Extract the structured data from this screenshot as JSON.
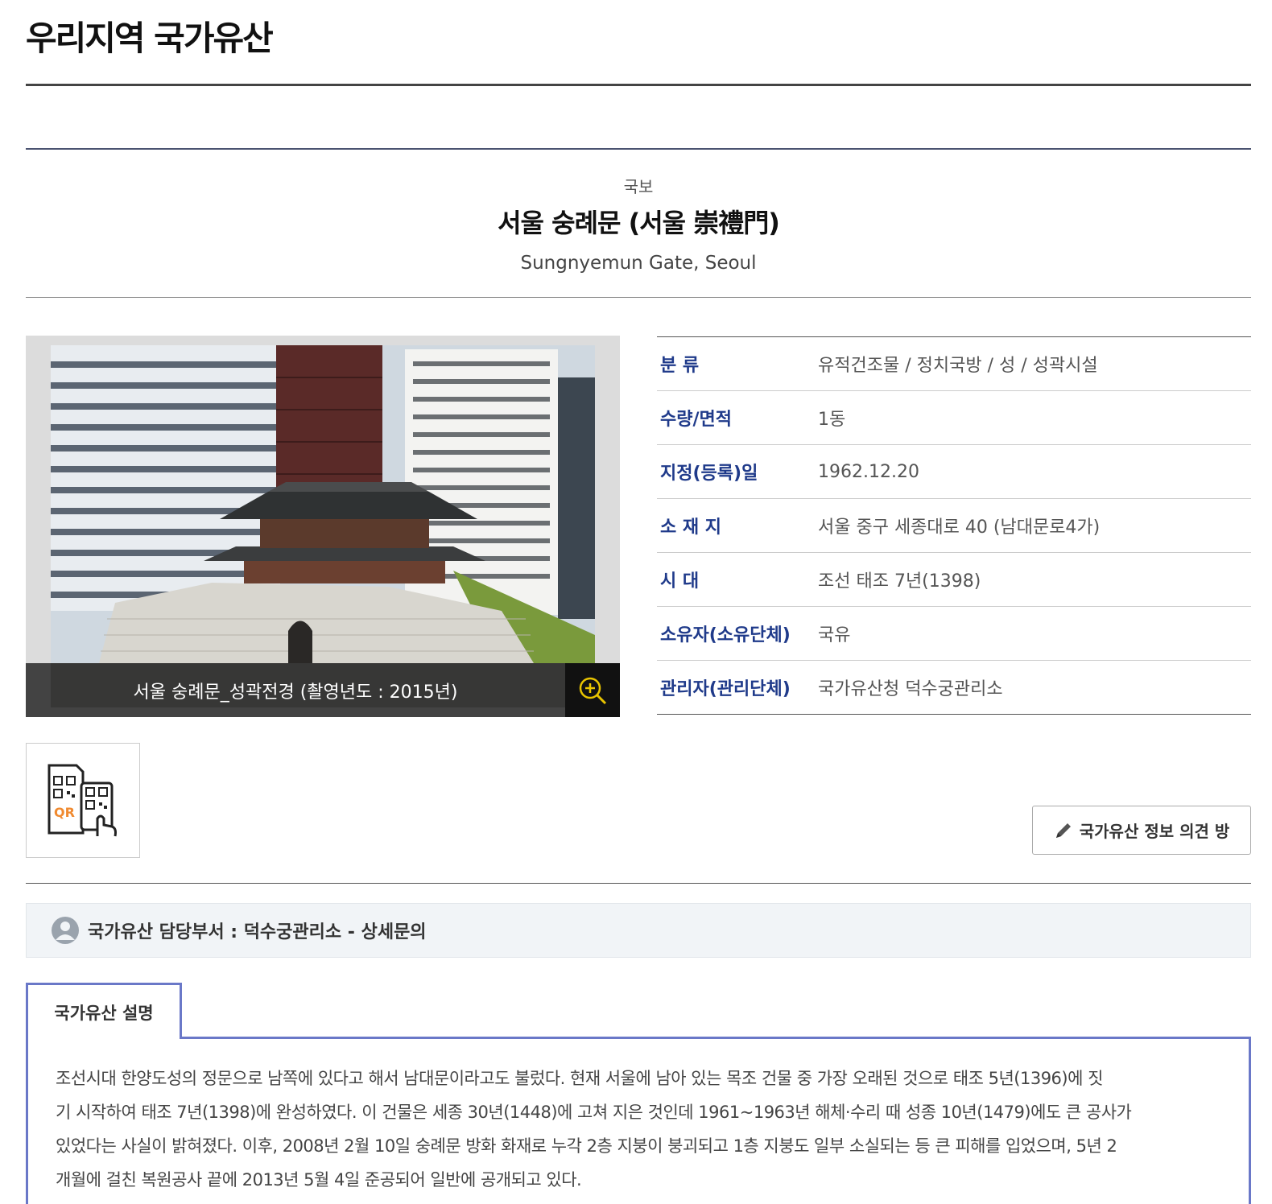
{
  "page": {
    "title": "우리지역 국가유산"
  },
  "heritage": {
    "category": "국보",
    "title": "서울 숭례문 (서울 崇禮門)",
    "english_title": "Sungnyemun Gate, Seoul"
  },
  "photo": {
    "caption": "서울 숭례문_성곽전경 (촬영년도 : 2015년)",
    "zoom_icon": "zoom-in-icon"
  },
  "info_rows": [
    {
      "label": "분 류",
      "value": "유적건조물 / 정치국방 / 성 / 성곽시설"
    },
    {
      "label": "수량/면적",
      "value": "1동"
    },
    {
      "label": "지정(등록)일",
      "value": "1962.12.20"
    },
    {
      "label": "소 재 지",
      "value": "서울 중구 세종대로 40 (남대문로4가)"
    },
    {
      "label": "시 대",
      "value": "조선 태조 7년(1398)"
    },
    {
      "label": "소유자(소유단체)",
      "value": "국유"
    },
    {
      "label": "관리자(관리단체)",
      "value": "국가유산청 덕수궁관리소"
    }
  ],
  "qr": {
    "label": "QR",
    "icon": "qr-code-icon"
  },
  "opinion_button": {
    "label": "국가유산 정보 의견 방",
    "icon": "pencil-icon"
  },
  "department": {
    "text": "국가유산 담당부서 : 덕수궁관리소 - 상세문의",
    "icon": "person-icon"
  },
  "description": {
    "tab_label": "국가유산 설명",
    "lines": [
      "조선시대 한양도성의 정문으로 남쪽에 있다고 해서 남대문이라고도 불렀다. 현재 서울에 남아 있는 목조 건물 중 가장 오래된 것으로 태조 5년(1396)에 짓",
      "기 시작하여 태조 7년(1398)에 완성하였다. 이 건물은 세종 30년(1448)에 고쳐 지은 것인데 1961~1963년 해체·수리 때 성종 10년(1479)에도 큰 공사가",
      "있었다는 사실이 밝혀졌다. 이후, 2008년 2월 10일 숭례문 방화 화재로 누각 2층 지붕이 붕괴되고 1층 지붕도 일부 소실되는 등 큰 피해를 입었으며, 5년 2",
      "개월에 걸친 복원공사 끝에 2013년 5월 4일 준공되어 일반에 공개되고 있다."
    ]
  },
  "colors": {
    "label_blue": "#1f3a8a",
    "tab_border": "#6a78c8",
    "dept_bg": "#f1f4f7"
  }
}
